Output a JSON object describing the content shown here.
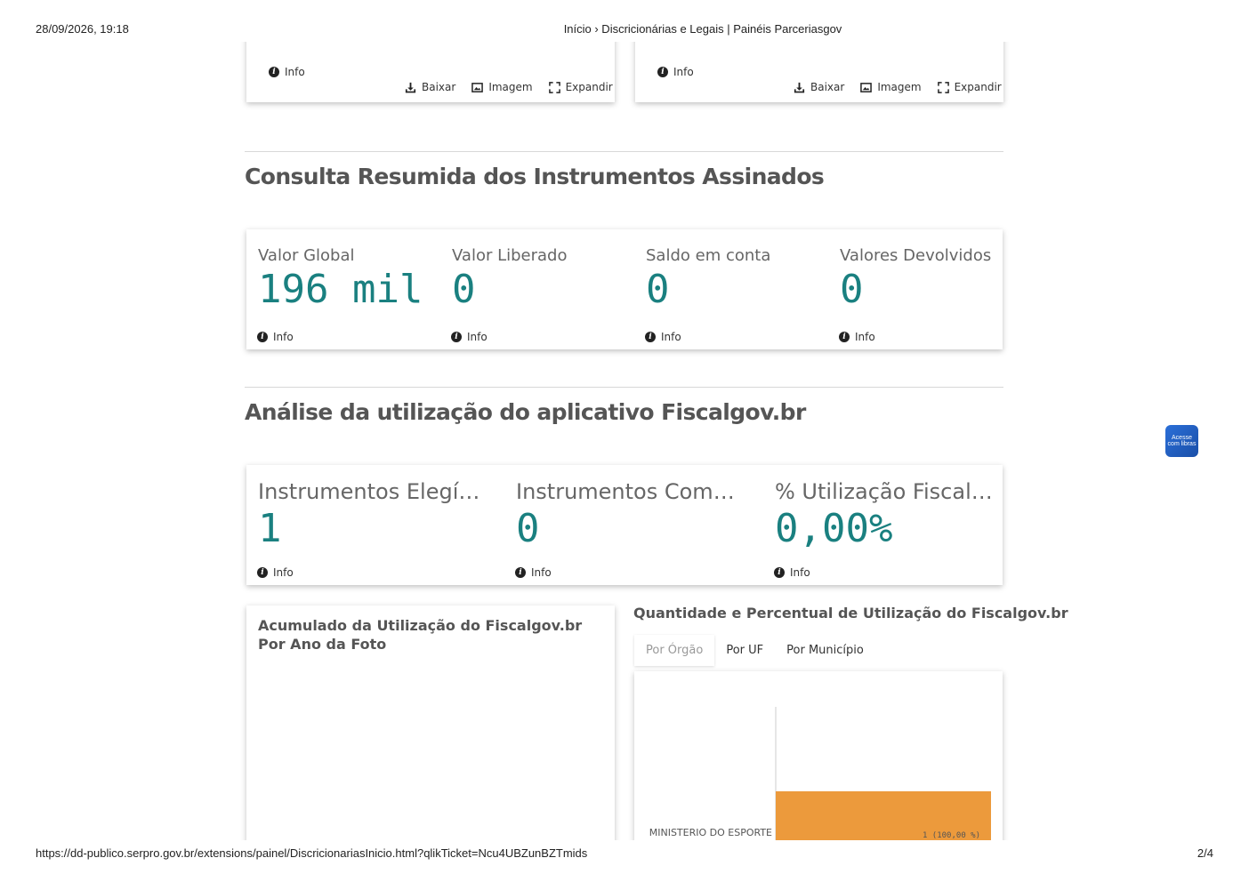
{
  "print": {
    "datetime": "28/09/2026, 19:18",
    "title": "Início › Discricionárias e Legais | Painéis Parceriasgov",
    "url": "https://dd-publico.serpro.gov.br/extensions/painel/DiscricionariasInicio.html?qlikTicket=Ncu4UBZunBZTmids",
    "page_number": "2/4"
  },
  "top_cards": [
    {
      "info": "Info",
      "download": "Baixar",
      "image": "Imagem",
      "expand": "Expandir"
    },
    {
      "info": "Info",
      "download": "Baixar",
      "image": "Imagem",
      "expand": "Expandir"
    }
  ],
  "section1": {
    "title": "Consulta Resumida dos Instrumentos Assinados",
    "kpis": [
      {
        "label": "Valor Global",
        "value": "196 mil",
        "info": "Info"
      },
      {
        "label": "Valor Liberado",
        "value": "0",
        "info": "Info"
      },
      {
        "label": "Saldo em conta",
        "value": "0",
        "info": "Info"
      },
      {
        "label": "Valores Devolvidos",
        "value": "0",
        "info": "Info"
      }
    ]
  },
  "section2": {
    "title": "Análise da utilização do aplicativo Fiscalgov.br",
    "kpis": [
      {
        "label": "Instrumentos Elegív...",
        "value": "1",
        "info": "Info"
      },
      {
        "label": "Instrumentos Com ...",
        "value": "0",
        "info": "Info"
      },
      {
        "label": "% Utilização Fiscalgo...",
        "value": "0,00%",
        "info": "Info"
      }
    ]
  },
  "left_chart": {
    "title": "Acumulado da Utilização do Fiscalgov.br Por Ano da Foto"
  },
  "right_chart": {
    "title": "Quantidade e Percentual de Utilização do Fiscalgov.br",
    "tabs": [
      "Por Órgão",
      "Por UF",
      "Por Município"
    ],
    "active_tab": 0
  },
  "chart_data": {
    "type": "bar",
    "orientation": "horizontal",
    "categories": [
      "MINISTERIO DO ESPORTE"
    ],
    "values": [
      1
    ],
    "data_labels": [
      "1 (100,00 %)"
    ],
    "color": "#ec9a3c"
  },
  "float_button": {
    "text": "Acesse com libras"
  },
  "colors": {
    "kpi_value": "#1a8080",
    "bar": "#ec9a3c"
  }
}
